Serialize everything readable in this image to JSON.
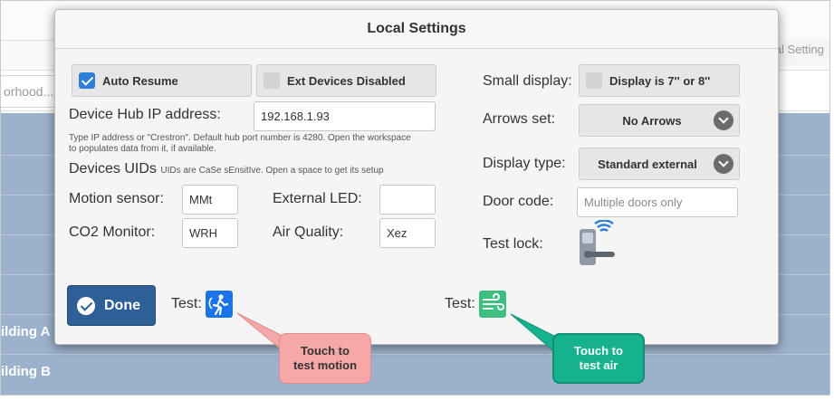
{
  "background": {
    "tab_label": "Local Setting",
    "search_text": "orhood...",
    "buildings": [
      "ilding A",
      "ilding B"
    ]
  },
  "dialog": {
    "title": "Local Settings",
    "auto_resume": {
      "label": "Auto Resume",
      "checked": true
    },
    "ext_devices": {
      "label": "Ext Devices Disabled",
      "checked": false
    },
    "hub_ip": {
      "label": "Device Hub IP address:",
      "value": "192.168.1.93",
      "hint": "Type IP address or \"Crestron\". Default hub port number is 4280. Open the workspace to populates data from it, if available."
    },
    "uids": {
      "title": "Devices UIDs",
      "hint": "UIDs are CaSe sEnsitIve. Open a space to get its setup"
    },
    "motion_sensor": {
      "label": "Motion sensor:",
      "value": "MMt"
    },
    "external_led": {
      "label": "External LED:",
      "value": ""
    },
    "co2_monitor": {
      "label": "CO2 Monitor:",
      "value": "WRH"
    },
    "air_quality": {
      "label": "Air Quality:",
      "value": "Xez"
    },
    "small_display": {
      "label": "Small display:",
      "option_label": "Display is 7'' or 8''",
      "checked": false
    },
    "arrows_set": {
      "label": "Arrows set:",
      "value": "No Arrows"
    },
    "display_type": {
      "label": "Display type:",
      "value": "Standard external"
    },
    "door_code": {
      "label": "Door code:",
      "placeholder": "Multiple doors only"
    },
    "test_lock": {
      "label": "Test lock:",
      "icon": "smart-lock-icon"
    },
    "done_label": "Done",
    "test_motion_label": "Test:",
    "test_air_label": "Test:"
  },
  "callouts": {
    "motion": "Touch to\ntest motion",
    "air": "Touch to\ntest air"
  },
  "colors": {
    "accent_blue": "#2b7fd6",
    "done_blue": "#2e5f96",
    "motion_icon": "#1a73e8",
    "air_icon": "#3fbf7f",
    "callout_pink": "#f6a7a8",
    "callout_teal": "#16b28e"
  }
}
